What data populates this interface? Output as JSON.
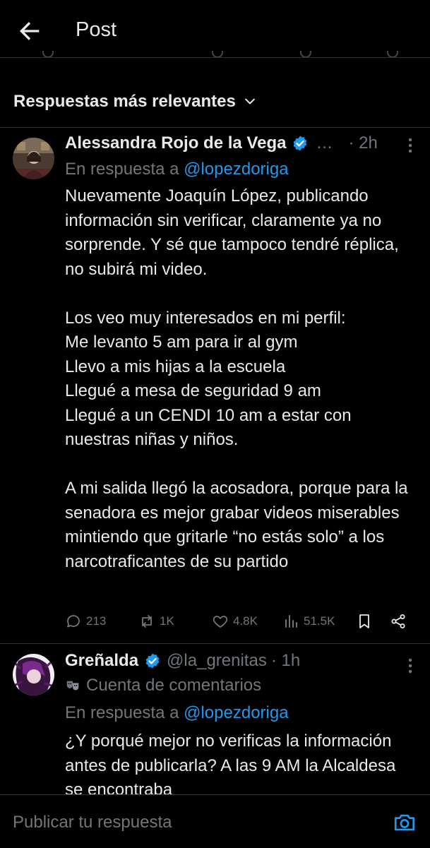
{
  "header": {
    "title": "Post",
    "back_icon": "arrow-left-icon"
  },
  "sort": {
    "label": "Respuestas más relevantes",
    "icon": "chevron-down-icon"
  },
  "replies": [
    {
      "name": "Alessandra Rojo de la Vega",
      "verified": true,
      "ellipsis": "…",
      "time": "· 2h",
      "reply_prefix": "En respuesta a ",
      "reply_handle": "@lopezdoriga",
      "text": "Nuevamente Joaquín López, publicando información sin verificar, claramente ya no sorprende. Y sé que tampoco tendré réplica, no subirá mi video.\n\nLos veo muy interesados en mi perfil:\nMe levanto 5 am para ir al gym\nLlevo a mis hijas a la escuela\nLlegué a mesa de seguridad 9 am\nLlegué a un CENDI 10 am a estar con nuestras niñas y niños.\n\nA mi salida llegó la acosadora, porque para la  senadora es mejor grabar videos miserables mintiendo que gritarle “no estás solo” a los narcotraficantes de su partido",
      "actions": {
        "replies": "213",
        "reposts": "1K",
        "likes": "4.8K",
        "views": "51.5K"
      }
    },
    {
      "name": "Greñalda",
      "verified": true,
      "handle": "@la_grenitas",
      "time": "· 1h",
      "community": "Cuenta de comentarios",
      "reply_prefix": "En respuesta a ",
      "reply_handle": "@lopezdoriga",
      "text": "¿Y porqué mejor no verificas la información antes de publicarla? A las 9 AM la Alcaldesa se encontraba"
    }
  ],
  "composer": {
    "placeholder": "Publicar tu respuesta",
    "camera_icon": "camera-icon"
  },
  "colors": {
    "accent": "#1d9bf0",
    "muted": "#71767b",
    "text": "#e7e9ea",
    "background": "#000000"
  }
}
